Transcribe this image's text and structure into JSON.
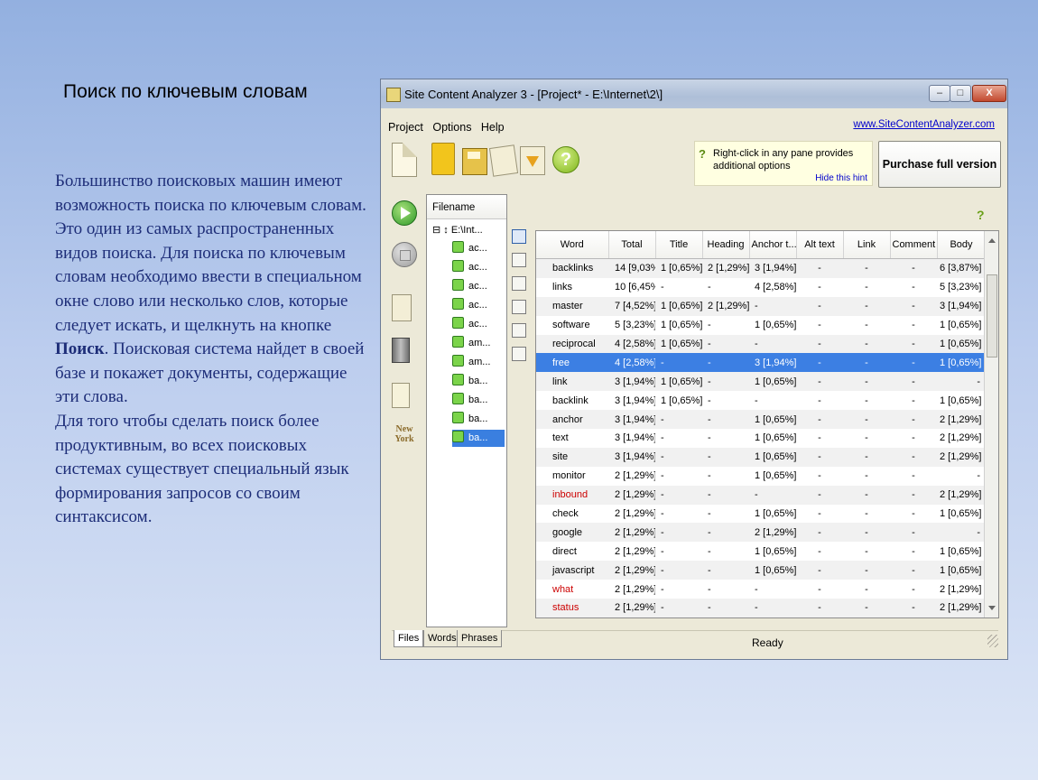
{
  "slide": {
    "title": "Поиск по ключевым словам",
    "body_p1_a": "Большинство поисковых машин имеют возможность поиска по ключевым словам. Это один из самых распространенных видов поиска. Для поиска по ключевым словам необходимо ввести в специальном окне слово или несколько слов, которые следует искать, и щелкнуть на кнопке ",
    "body_p1_bold": "Поиск",
    "body_p1_b": ". Поисковая система найдет в своей базе и покажет документы, содержащие эти слова.",
    "body_p2": "Для того чтобы сделать поиск более продуктивным, во всех поисковых системах существует специальный язык формирования запросов со своим синтаксисом."
  },
  "window": {
    "title": "Site Content Analyzer 3 - [Project* - E:\\Internet\\2\\]",
    "min_label": "–",
    "max_label": "□",
    "close_label": "X"
  },
  "menu": {
    "project": "Project",
    "options": "Options",
    "help": "Help",
    "site_link": "www.SiteContentAnalyzer.com"
  },
  "toolbar": {
    "help_glyph": "?"
  },
  "hint": {
    "icon": "?",
    "text": "Right-click in any pane provides additional options",
    "hide": "Hide this hint"
  },
  "purchase_label": "Purchase full version",
  "sidebar": {
    "ny_logo": "New York"
  },
  "files": {
    "header": "Filename",
    "root": "⊟ ↕ E:\\Int...",
    "items": [
      "ac...",
      "ac...",
      "ac...",
      "ac...",
      "ac...",
      "am...",
      "am...",
      "ba...",
      "ba...",
      "ba...",
      "ba..."
    ],
    "selected_index": 10
  },
  "help2": "?",
  "table": {
    "headers": [
      "Word",
      "Total",
      "Title",
      "Heading",
      "Anchor t...",
      "Alt text",
      "Link",
      "Comment",
      "Body"
    ],
    "rows": [
      {
        "word": "backlinks",
        "total": "14 [9,03%]",
        "title": "1 [0,65%]",
        "heading": "2 [1,29%]",
        "anchor": "3 [1,94%]",
        "alt": "-",
        "link": "-",
        "comment": "-",
        "body": "6 [3,87%]",
        "red": false
      },
      {
        "word": "links",
        "total": "10 [6,45%]",
        "title": "-",
        "heading": "-",
        "anchor": "4 [2,58%]",
        "alt": "-",
        "link": "-",
        "comment": "-",
        "body": "5 [3,23%]",
        "red": false
      },
      {
        "word": "master",
        "total": "7 [4,52%]",
        "title": "1 [0,65%]",
        "heading": "2 [1,29%]",
        "anchor": "-",
        "alt": "-",
        "link": "-",
        "comment": "-",
        "body": "3 [1,94%]",
        "red": false
      },
      {
        "word": "software",
        "total": "5 [3,23%]",
        "title": "1 [0,65%]",
        "heading": "-",
        "anchor": "1 [0,65%]",
        "alt": "-",
        "link": "-",
        "comment": "-",
        "body": "1 [0,65%]",
        "red": false
      },
      {
        "word": "reciprocal",
        "total": "4 [2,58%]",
        "title": "1 [0,65%]",
        "heading": "-",
        "anchor": "-",
        "alt": "-",
        "link": "-",
        "comment": "-",
        "body": "1 [0,65%]",
        "red": false
      },
      {
        "word": "free",
        "total": "4 [2,58%]",
        "title": "-",
        "heading": "-",
        "anchor": "3 [1,94%]",
        "alt": "-",
        "link": "-",
        "comment": "-",
        "body": "1 [0,65%]",
        "red": false
      },
      {
        "word": "link",
        "total": "3 [1,94%]",
        "title": "1 [0,65%]",
        "heading": "-",
        "anchor": "1 [0,65%]",
        "alt": "-",
        "link": "-",
        "comment": "-",
        "body": "-",
        "red": false
      },
      {
        "word": "backlink",
        "total": "3 [1,94%]",
        "title": "1 [0,65%]",
        "heading": "-",
        "anchor": "-",
        "alt": "-",
        "link": "-",
        "comment": "-",
        "body": "1 [0,65%]",
        "red": false
      },
      {
        "word": "anchor",
        "total": "3 [1,94%]",
        "title": "-",
        "heading": "-",
        "anchor": "1 [0,65%]",
        "alt": "-",
        "link": "-",
        "comment": "-",
        "body": "2 [1,29%]",
        "red": false
      },
      {
        "word": "text",
        "total": "3 [1,94%]",
        "title": "-",
        "heading": "-",
        "anchor": "1 [0,65%]",
        "alt": "-",
        "link": "-",
        "comment": "-",
        "body": "2 [1,29%]",
        "red": false
      },
      {
        "word": "site",
        "total": "3 [1,94%]",
        "title": "-",
        "heading": "-",
        "anchor": "1 [0,65%]",
        "alt": "-",
        "link": "-",
        "comment": "-",
        "body": "2 [1,29%]",
        "red": false
      },
      {
        "word": "monitor",
        "total": "2 [1,29%]",
        "title": "-",
        "heading": "-",
        "anchor": "1 [0,65%]",
        "alt": "-",
        "link": "-",
        "comment": "-",
        "body": "-",
        "red": false
      },
      {
        "word": "inbound",
        "total": "2 [1,29%]",
        "title": "-",
        "heading": "-",
        "anchor": "-",
        "alt": "-",
        "link": "-",
        "comment": "-",
        "body": "2 [1,29%]",
        "red": true
      },
      {
        "word": "check",
        "total": "2 [1,29%]",
        "title": "-",
        "heading": "-",
        "anchor": "1 [0,65%]",
        "alt": "-",
        "link": "-",
        "comment": "-",
        "body": "1 [0,65%]",
        "red": false
      },
      {
        "word": "google",
        "total": "2 [1,29%]",
        "title": "-",
        "heading": "-",
        "anchor": "2 [1,29%]",
        "alt": "-",
        "link": "-",
        "comment": "-",
        "body": "-",
        "red": false
      },
      {
        "word": "direct",
        "total": "2 [1,29%]",
        "title": "-",
        "heading": "-",
        "anchor": "1 [0,65%]",
        "alt": "-",
        "link": "-",
        "comment": "-",
        "body": "1 [0,65%]",
        "red": false
      },
      {
        "word": "javascript",
        "total": "2 [1,29%]",
        "title": "-",
        "heading": "-",
        "anchor": "1 [0,65%]",
        "alt": "-",
        "link": "-",
        "comment": "-",
        "body": "1 [0,65%]",
        "red": false
      },
      {
        "word": "what",
        "total": "2 [1,29%]",
        "title": "-",
        "heading": "-",
        "anchor": "-",
        "alt": "-",
        "link": "-",
        "comment": "-",
        "body": "2 [1,29%]",
        "red": true
      },
      {
        "word": "status",
        "total": "2 [1,29%]",
        "title": "-",
        "heading": "-",
        "anchor": "-",
        "alt": "-",
        "link": "-",
        "comment": "-",
        "body": "2 [1,29%]",
        "red": true
      }
    ],
    "selected_index": 5
  },
  "tabs": [
    "Files",
    "Words",
    "Phrases"
  ],
  "active_tab": 0,
  "status": "Ready",
  "colors": {
    "selection": "#3c7fe3",
    "red_word": "#cc0000",
    "link": "#0000cc",
    "slide_text": "#1d2d78"
  },
  "icons": {
    "toolbar": [
      "new-document-icon",
      "open-folder-icon",
      "save-icon",
      "export-icon",
      "import-icon",
      "help-icon"
    ],
    "sidebar": [
      "start-icon",
      "stop-icon",
      "report-icon",
      "delete-icon",
      "clear-icon",
      "new-york-logo"
    ],
    "view": [
      "table-view-icon",
      "list-view-icon",
      "report-view-icon",
      "chart-view-icon",
      "stats-view-icon",
      "options-view-icon"
    ]
  }
}
